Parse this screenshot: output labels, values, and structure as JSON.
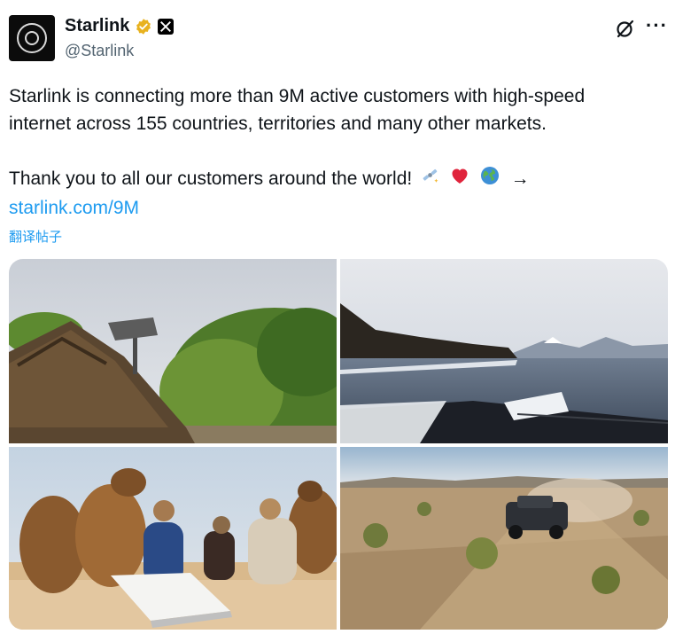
{
  "author": {
    "display_name": "Starlink",
    "handle": "@Starlink",
    "avatar_icon": "starlink-logo-icon",
    "verified_icon": "verified-badge-icon",
    "affiliate_icon": "x-affiliate-icon"
  },
  "header_actions": {
    "grok_icon": "grok-icon",
    "more_label": "···"
  },
  "post": {
    "line1": "Starlink is connecting more than 9M active customers with high-speed",
    "line2": "internet across 155 countries, territories and many other markets.",
    "line3": "Thank you to all our customers around the world!",
    "arrow": "→",
    "emojis": [
      "satellite-sparkle",
      "red-heart",
      "globe"
    ],
    "link": "starlink.com/9M",
    "translate_label": "翻译帖子"
  },
  "media": {
    "images": [
      {
        "label": "thatched-hut-with-dish"
      },
      {
        "label": "lake-with-dish-on-car"
      },
      {
        "label": "camels-and-people-desert"
      },
      {
        "label": "truck-driving-desert"
      }
    ]
  },
  "colors": {
    "accent": "#1d9bf0",
    "text": "#0f1419",
    "secondary": "#536471",
    "verified_gold": "#e8b21f"
  }
}
